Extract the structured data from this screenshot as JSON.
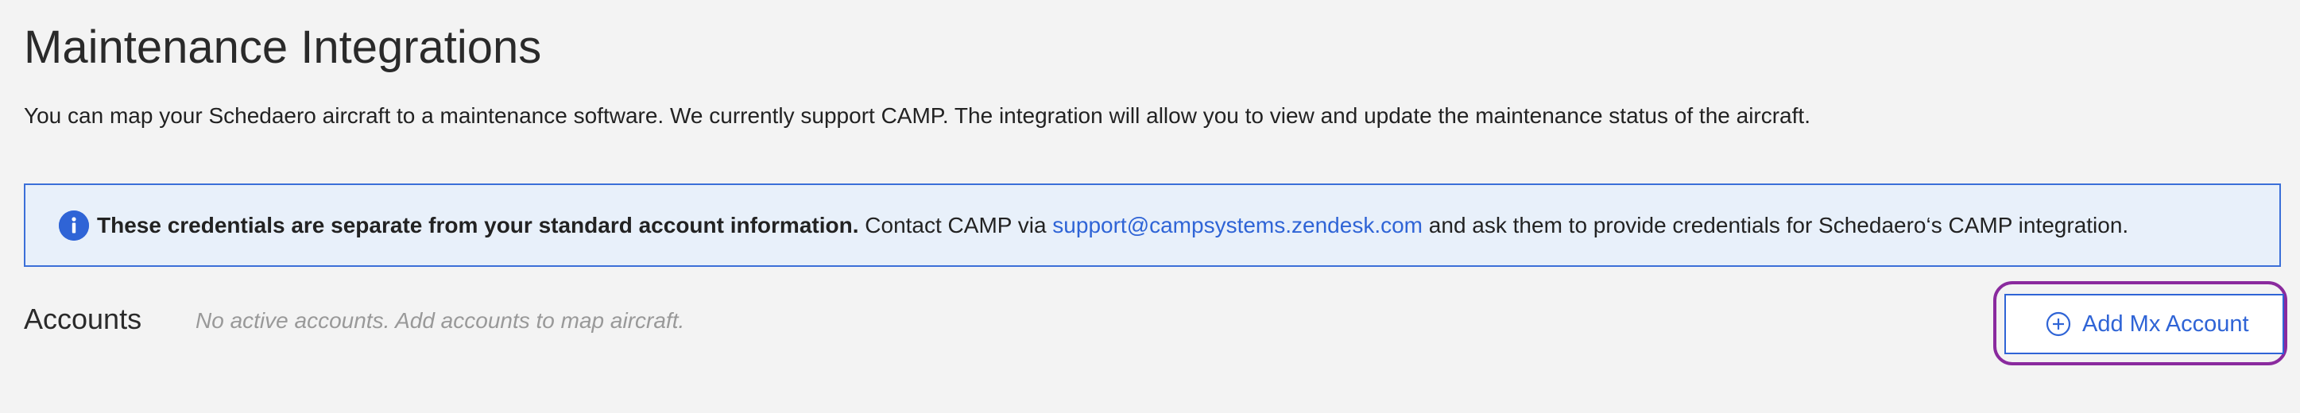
{
  "page": {
    "title": "Maintenance Integrations",
    "description": "You can map your Schedaero aircraft to a maintenance software. We currently support CAMP. The integration will allow you to view and update the maintenance status of the aircraft."
  },
  "info_banner": {
    "icon": "info-icon",
    "bold_text": "These credentials are separate from your standard account information.",
    "text_before_link": " Contact CAMP via ",
    "link_text": "support@campsystems.zendesk.com",
    "text_after_link": " and ask them to provide credentials for Schedaero‘s CAMP integration.",
    "accent_color": "#2f64d6",
    "background_color": "#e8f0fa"
  },
  "accounts": {
    "label": "Accounts",
    "empty_message": "No active accounts. Add accounts to map aircraft.",
    "add_button_label": "Add Mx Account",
    "add_button_icon": "plus-circle-icon",
    "focus_ring_color": "#8a2a9e"
  }
}
